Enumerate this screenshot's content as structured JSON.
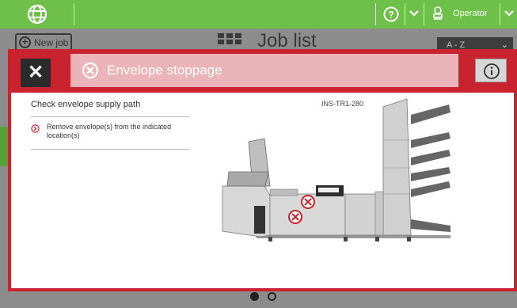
{
  "topbar": {
    "globe_icon": "globe-icon",
    "help_icon": "help-circle-icon",
    "user_icon": "user-icon",
    "operator_label": "Operator",
    "color": "#6fc04a"
  },
  "background": {
    "new_job_label": "New job",
    "page_title": "Job list",
    "sort_value": "A - Z"
  },
  "modal": {
    "close_label": "✕",
    "title": "Envelope stoppage",
    "accent_color": "#c8232e",
    "heading": "Check envelope supply path",
    "steps": [
      {
        "text": "Remove envelope(s) from the indicated location(s)"
      }
    ],
    "code": "INS-TR1-280"
  },
  "pagination": {
    "pages": 2,
    "current": 1
  }
}
